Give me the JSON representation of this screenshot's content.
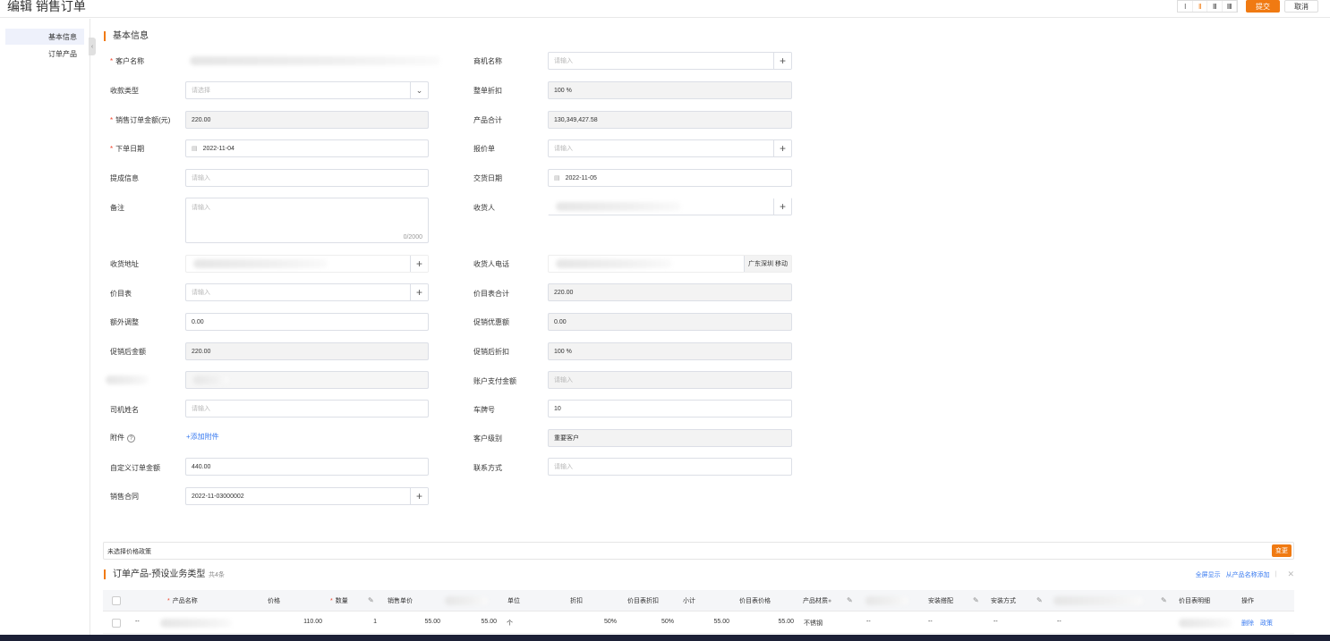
{
  "header": {
    "title": "编辑 销售订单",
    "layout_options": [
      "I",
      "II",
      "III",
      "IIII"
    ],
    "submit_label": "提交",
    "cancel_label": "取消"
  },
  "sidebar": {
    "items": [
      {
        "label": "基本信息",
        "active": true
      },
      {
        "label": "订单产品",
        "active": false
      }
    ]
  },
  "basic": {
    "section_title": "基本信息",
    "fields": {
      "customer_name": {
        "label": "客户名称",
        "required": true
      },
      "opportunity_name": {
        "label": "商机名称",
        "placeholder": "请输入"
      },
      "payment_type": {
        "label": "收款类型",
        "placeholder": "请选择"
      },
      "total_discount": {
        "label": "整单折扣",
        "value": "100 %"
      },
      "order_amount": {
        "label": "销售订单金额(元)",
        "required": true,
        "value": "220.00"
      },
      "product_total": {
        "label": "产品合计",
        "value": "130,349,427.58"
      },
      "order_date": {
        "label": "下单日期",
        "required": true,
        "value": "2022-11-04"
      },
      "quote": {
        "label": "报价单",
        "placeholder": "请输入"
      },
      "commission_info": {
        "label": "提成信息",
        "placeholder": "请输入"
      },
      "delivery_date": {
        "label": "交货日期",
        "value": "2022-11-05"
      },
      "remark": {
        "label": "备注",
        "placeholder": "请输入",
        "counter": "0/2000"
      },
      "consignee": {
        "label": "收货人"
      },
      "shipping_address": {
        "label": "收货地址"
      },
      "consignee_phone": {
        "label": "收货人电话",
        "region": "广东深圳 移动"
      },
      "price_list": {
        "label": "价目表",
        "placeholder": "请输入"
      },
      "price_list_total": {
        "label": "价目表合计",
        "value": "220.00"
      },
      "extra_adjust": {
        "label": "额外调整",
        "value": "0.00"
      },
      "promo_discount_amount": {
        "label": "促销优惠额",
        "value": "0.00"
      },
      "amount_after_promo": {
        "label": "促销后金额",
        "value": "220.00"
      },
      "discount_after_promo": {
        "label": "促销后折扣",
        "value": "100 %"
      },
      "account_payment": {
        "label": "账户支付金额",
        "placeholder": "请输入"
      },
      "driver_name": {
        "label": "司机姓名",
        "placeholder": "请输入"
      },
      "plate_number": {
        "label": "车牌号",
        "value": "10"
      },
      "attachment": {
        "label": "附件",
        "help": "?",
        "add_label": "+添加附件"
      },
      "customer_level": {
        "label": "客户级别",
        "value": "重要客户"
      },
      "custom_order_amount": {
        "label": "自定义订单金额",
        "value": "440.00"
      },
      "contact": {
        "label": "联系方式",
        "placeholder": "请输入"
      },
      "sales_contract": {
        "label": "销售合同",
        "value": "2022-11-03000002"
      }
    }
  },
  "policy": {
    "text": "未选择价格政策",
    "change_label": "变更"
  },
  "products": {
    "title": "订单产品-预设业务类型",
    "count": "共4条",
    "full_screen": "全屏显示",
    "add_from_name": "从产品名称添加",
    "close_icon": "close-icon",
    "columns": {
      "name": "产品名称",
      "price": "价格",
      "quantity": "数量",
      "sale_price": "销售单价",
      "unit": "单位",
      "discount": "折扣",
      "pricelist_discount": "价目表折扣",
      "subtotal": "小计",
      "pricelist_price": "价目表价格",
      "material": "产品材质",
      "install_match": "安装搭配",
      "install_method": "安装方式",
      "pricelist_detail": "价目表明细",
      "actions": "操作"
    },
    "rows": [
      {
        "dash": "--",
        "price": "110.00",
        "quantity": "1",
        "sale_price": "55.00",
        "sale_price2": "55.00",
        "unit": "个",
        "discount": "50%",
        "pricelist_discount": "50%",
        "subtotal": "55.00",
        "pricelist_price": "55.00",
        "material": "不锈钢",
        "dash2": "--",
        "dash3": "--",
        "dash4": "--",
        "dash5": "--",
        "delete": "删除",
        "policy": "政策"
      }
    ]
  },
  "colors": {
    "accent": "#f07a12",
    "link": "#3a7bf0",
    "required": "#f0442c",
    "bottom_strip": "#1c2036"
  }
}
